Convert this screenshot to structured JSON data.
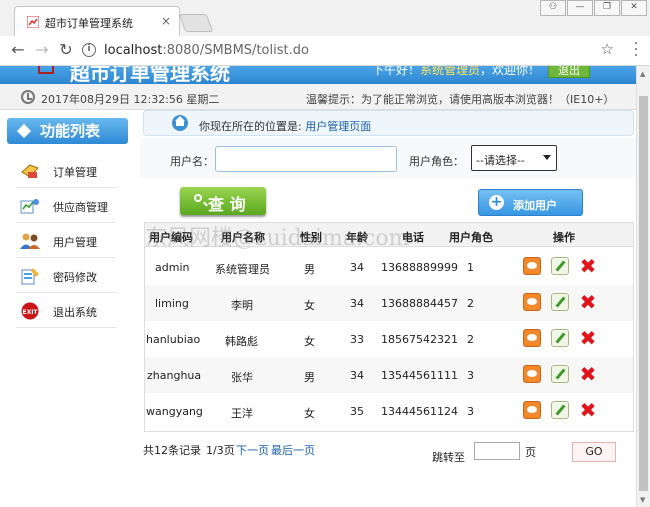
{
  "browser": {
    "tab_title": "超市订单管理系统",
    "tab_close": "×",
    "url_host": "localhost",
    "url_rest": ":8080/SMBMS/tolist.do",
    "window_buttons": [
      "⚇",
      "—",
      "❐",
      "✕"
    ]
  },
  "header": {
    "brand": "超市订单管理系统",
    "welcome_prefix": "下午好！",
    "welcome_user": "系统管理员",
    "welcome_suffix": "，欢迎你！",
    "logout": "退出"
  },
  "infobar": {
    "datetime": "2017年08月29日 12:32:56 星期二",
    "tip": "温馨提示：为了能正常浏览，请使用高版本浏览器！（IE10+）"
  },
  "sidebar": {
    "title": "功能列表",
    "items": [
      {
        "label": "订单管理"
      },
      {
        "label": "供应商管理"
      },
      {
        "label": "用户管理"
      },
      {
        "label": "密码修改"
      },
      {
        "label": "退出系统"
      }
    ]
  },
  "breadcrumb": {
    "prefix": "你现在所在的位置是:",
    "current": "用户管理页面"
  },
  "search": {
    "username_label": "用户名：",
    "username_value": "",
    "role_label": "用户角色：",
    "role_selected": "--请选择--",
    "query_label": "查 询",
    "add_label": "添加用户"
  },
  "table": {
    "headers": [
      "用户编码",
      "用户名称",
      "性别",
      "年龄",
      "电话",
      "用户角色",
      "操作"
    ],
    "rows": [
      [
        "admin",
        "系统管理员",
        "男",
        "34",
        "13688889999",
        "1"
      ],
      [
        "liming",
        "李明",
        "女",
        "34",
        "13688884457",
        "2"
      ],
      [
        "hanlubiao",
        "韩路彪",
        "女",
        "33",
        "18567542321",
        "2"
      ],
      [
        "zhanghua",
        "张华",
        "男",
        "34",
        "13544561111",
        "3"
      ],
      [
        "wangyang",
        "王洋",
        "女",
        "35",
        "13444561124",
        "3"
      ]
    ],
    "watermark": "东风网楼@zuidaima.com"
  },
  "pager": {
    "summary": "共12条记录",
    "pageinfo": "1/3页",
    "next": "下一页",
    "last": "最后一页",
    "jump_label": "跳转至",
    "jump_value": "",
    "unit": "页",
    "go": "GO"
  }
}
